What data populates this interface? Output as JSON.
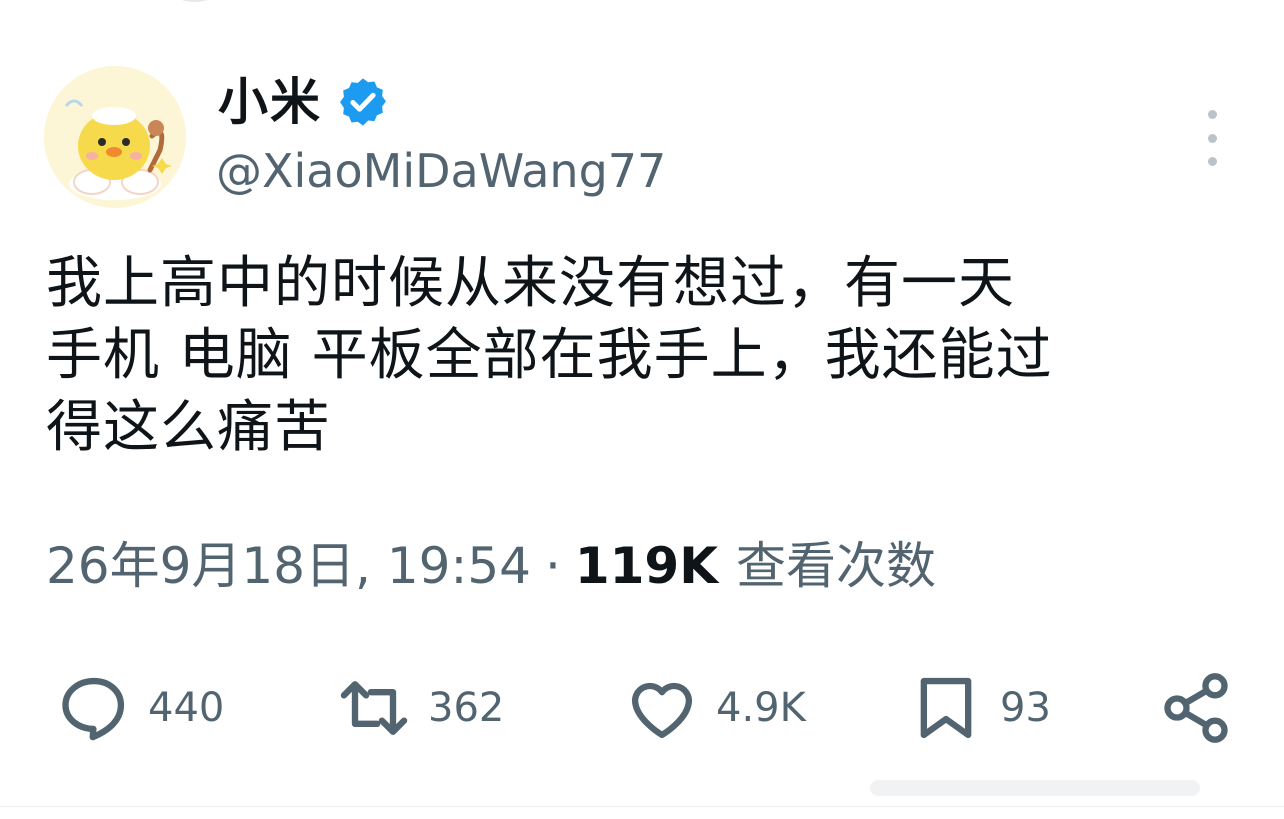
{
  "profile": {
    "display_name": "小米",
    "handle": "@XiaoMiDaWang77",
    "verified": true
  },
  "tweet": {
    "text": "我上高中的时候从来没有想过，有一天\n手机 电脑 平板全部在我手上，我还能过\n得这么痛苦",
    "timestamp": "26年9月18日, 19:54",
    "separator": "·",
    "views_count": "119K",
    "views_label": "查看次数"
  },
  "actions": {
    "replies": "440",
    "retweets": "362",
    "likes": "4.9K",
    "bookmarks": "93"
  },
  "colors": {
    "text": "#0f1419",
    "muted": "#536471",
    "verified": "#1d9bf0"
  },
  "icons": [
    "verified-badge-icon",
    "more-options-icon",
    "reply-icon",
    "retweet-icon",
    "like-icon",
    "bookmark-icon",
    "share-icon"
  ]
}
